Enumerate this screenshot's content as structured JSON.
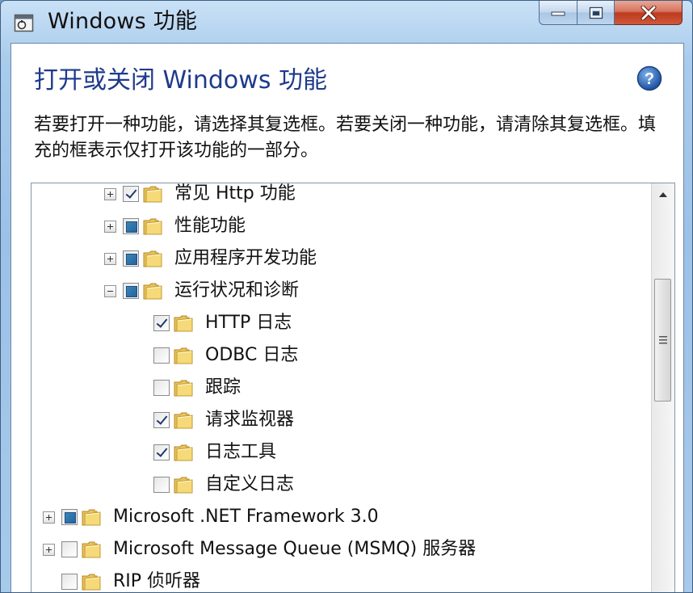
{
  "window": {
    "title": "Windows 功能"
  },
  "dialog": {
    "heading": "打开或关闭 Windows 功能",
    "description": "若要打开一种功能，请选择其复选框。若要关闭一种功能，请清除其复选框。填充的框表示仅打开该功能的一部分。"
  },
  "tree": {
    "items": [
      {
        "label": "常见 Http 功能",
        "expander": "plus",
        "state": "checked",
        "level": 2
      },
      {
        "label": "性能功能",
        "expander": "plus",
        "state": "partial",
        "level": 2
      },
      {
        "label": "应用程序开发功能",
        "expander": "plus",
        "state": "partial",
        "level": 2
      },
      {
        "label": "运行状况和诊断",
        "expander": "minus",
        "state": "partial",
        "level": 2
      },
      {
        "label": "HTTP 日志",
        "expander": "none",
        "state": "checked",
        "level": 3
      },
      {
        "label": "ODBC 日志",
        "expander": "none",
        "state": "unchecked",
        "level": 3
      },
      {
        "label": "跟踪",
        "expander": "none",
        "state": "unchecked",
        "level": 3
      },
      {
        "label": "请求监视器",
        "expander": "none",
        "state": "checked",
        "level": 3
      },
      {
        "label": "日志工具",
        "expander": "none",
        "state": "checked",
        "level": 3
      },
      {
        "label": "自定义日志",
        "expander": "none",
        "state": "unchecked",
        "level": 3
      },
      {
        "label": "Microsoft .NET Framework 3.0",
        "expander": "plus",
        "state": "partial",
        "level": 0
      },
      {
        "label": "Microsoft Message Queue (MSMQ) 服务器",
        "expander": "plus",
        "state": "unchecked",
        "level": 0
      },
      {
        "label": "RIP 侦听器",
        "expander": "none",
        "state": "unchecked",
        "level": 0
      }
    ]
  },
  "colors": {
    "heading": "#1e3a8c",
    "partial_fill": "#2463a0",
    "close_button": "#c94a2e"
  }
}
